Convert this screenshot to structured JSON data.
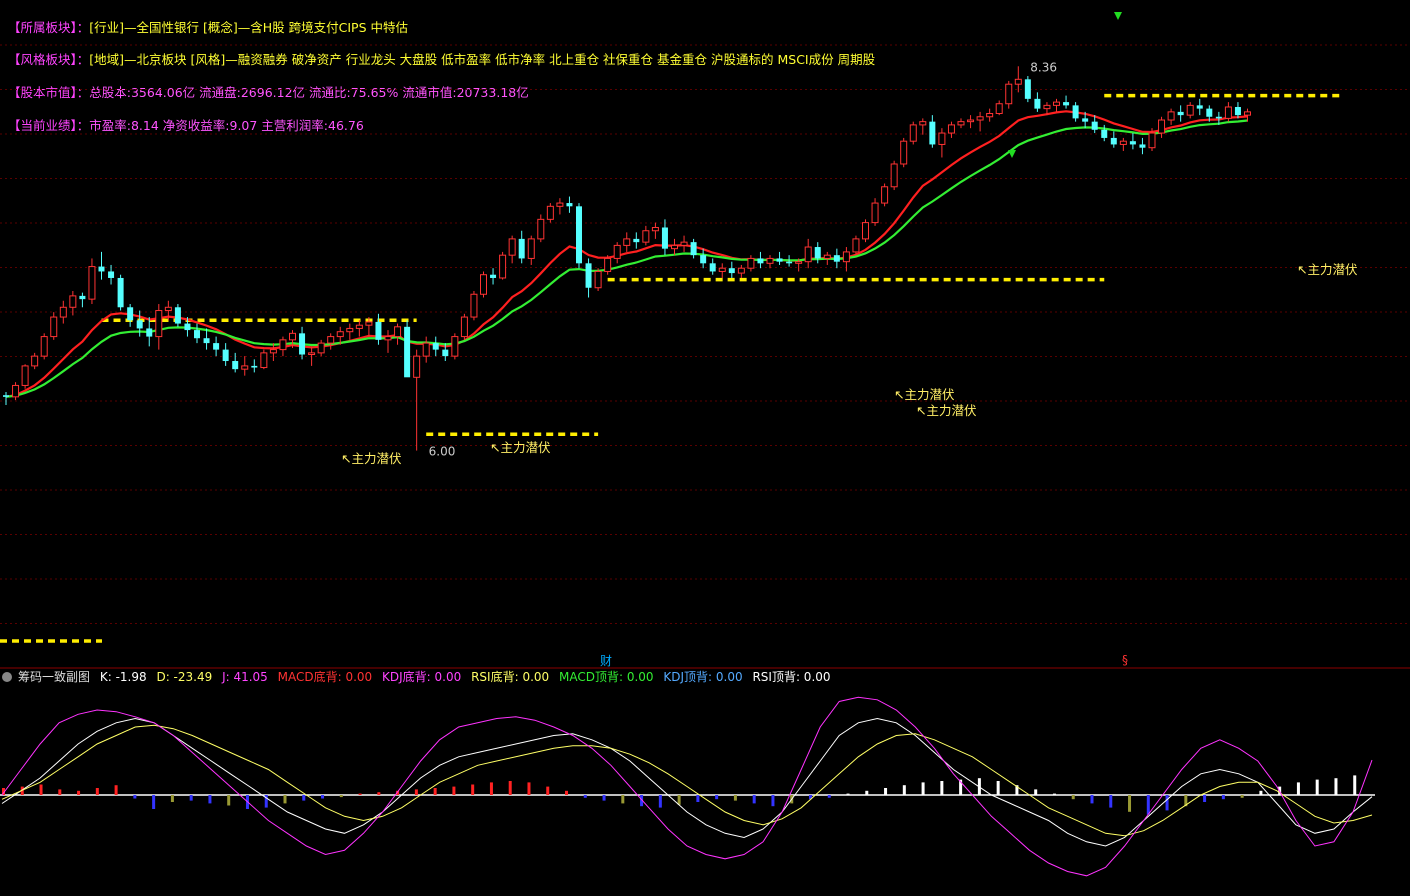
{
  "info_panel": {
    "sector": {
      "label": "【所属板块】：",
      "value": "[行业]—全国性银行 [概念]—含H股 跨境支付CIPS 中特估"
    },
    "style": {
      "label": "【风格板块】：",
      "value": "[地域]—北京板块 [风格]—融资融券 破净资产 行业龙头 大盘股 低市盈率 低市净率 北上重仓 社保重仓 基金重仓 沪股通标的 MSCI成份 周期股"
    },
    "capital": {
      "label": "【股本市值】：",
      "value": "总股本:3564.06亿 流通盘:2696.12亿 流通比:75.65% 流通市值:20733.18亿"
    },
    "performance": {
      "label": "【当前业绩】：",
      "value": "市盈率:8.14 净资收益率:9.07 主营利润率:46.76"
    }
  },
  "markers": {
    "cai": "财",
    "ss": "§"
  },
  "indicator_header": {
    "title": "筹码一致副图",
    "k": "K: -1.98",
    "d": "D: -23.49",
    "j": "J: 41.05",
    "macd_bottom": "MACD底背: 0.00",
    "kdj_bottom": "KDJ底背: 0.00",
    "rsi_bottom": "RSI底背: 0.00",
    "macd_top": "MACD顶背: 0.00",
    "kdj_top": "KDJ顶背: 0.00",
    "rsi_top": "RSI顶背: 0.00"
  },
  "colors": {
    "background": "#000000",
    "up_candle": "#ff3333",
    "down_candle": "#55ffff",
    "ma_fast": "#ff2020",
    "ma_slow": "#33ee33",
    "support_line": "#ffee00",
    "k_line": "#ffffff",
    "d_line": "#ffff66",
    "j_line": "#ff33ff"
  },
  "chart_data": [
    {
      "type": "candlestick",
      "max_label": "8.36",
      "min_label": "6.00",
      "annotation": "主力潜伏",
      "candles": [
        [
          6.34,
          6.36,
          6.28,
          6.33
        ],
        [
          6.33,
          6.42,
          6.31,
          6.4
        ],
        [
          6.4,
          6.53,
          6.38,
          6.52
        ],
        [
          6.52,
          6.6,
          6.5,
          6.58
        ],
        [
          6.58,
          6.72,
          6.56,
          6.7
        ],
        [
          6.7,
          6.85,
          6.68,
          6.82
        ],
        [
          6.82,
          6.92,
          6.78,
          6.88
        ],
        [
          6.88,
          6.98,
          6.83,
          6.95
        ],
        [
          6.95,
          6.97,
          6.88,
          6.93
        ],
        [
          6.93,
          7.18,
          6.9,
          7.13
        ],
        [
          7.13,
          7.22,
          7.05,
          7.1
        ],
        [
          7.1,
          7.14,
          7.02,
          7.06
        ],
        [
          7.06,
          7.08,
          6.86,
          6.88
        ],
        [
          6.88,
          6.9,
          6.76,
          6.8
        ],
        [
          6.8,
          6.86,
          6.7,
          6.75
        ],
        [
          6.75,
          6.82,
          6.64,
          6.7
        ],
        [
          6.7,
          6.9,
          6.62,
          6.86
        ],
        [
          6.86,
          6.92,
          6.8,
          6.88
        ],
        [
          6.88,
          6.9,
          6.76,
          6.78
        ],
        [
          6.78,
          6.82,
          6.7,
          6.74
        ],
        [
          6.74,
          6.78,
          6.66,
          6.69
        ],
        [
          6.69,
          6.75,
          6.62,
          6.66
        ],
        [
          6.66,
          6.7,
          6.58,
          6.62
        ],
        [
          6.62,
          6.66,
          6.52,
          6.55
        ],
        [
          6.55,
          6.6,
          6.48,
          6.5
        ],
        [
          6.5,
          6.58,
          6.46,
          6.52
        ],
        [
          6.52,
          6.56,
          6.48,
          6.51
        ],
        [
          6.51,
          6.62,
          6.5,
          6.6
        ],
        [
          6.6,
          6.66,
          6.55,
          6.62
        ],
        [
          6.62,
          6.7,
          6.58,
          6.68
        ],
        [
          6.68,
          6.74,
          6.63,
          6.72
        ],
        [
          6.72,
          6.76,
          6.56,
          6.59
        ],
        [
          6.59,
          6.64,
          6.52,
          6.6
        ],
        [
          6.6,
          6.68,
          6.58,
          6.66
        ],
        [
          6.66,
          6.72,
          6.62,
          6.7
        ],
        [
          6.7,
          6.76,
          6.65,
          6.73
        ],
        [
          6.73,
          6.78,
          6.68,
          6.75
        ],
        [
          6.75,
          6.8,
          6.7,
          6.77
        ],
        [
          6.77,
          6.82,
          6.7,
          6.79
        ],
        [
          6.79,
          6.84,
          6.65,
          6.68
        ],
        [
          6.68,
          6.74,
          6.6,
          6.7
        ],
        [
          6.7,
          6.78,
          6.65,
          6.76
        ],
        [
          6.76,
          6.8,
          6.52,
          6.45
        ],
        [
          6.45,
          6.62,
          6.0,
          6.58
        ],
        [
          6.58,
          6.7,
          6.54,
          6.66
        ],
        [
          6.66,
          6.7,
          6.58,
          6.62
        ],
        [
          6.62,
          6.66,
          6.55,
          6.58
        ],
        [
          6.58,
          6.72,
          6.56,
          6.7
        ],
        [
          6.7,
          6.84,
          6.68,
          6.82
        ],
        [
          6.82,
          6.98,
          6.8,
          6.96
        ],
        [
          6.96,
          7.1,
          6.94,
          7.08
        ],
        [
          7.08,
          7.12,
          7.02,
          7.06
        ],
        [
          7.06,
          7.22,
          7.05,
          7.2
        ],
        [
          7.2,
          7.32,
          7.15,
          7.3
        ],
        [
          7.3,
          7.35,
          7.15,
          7.18
        ],
        [
          7.18,
          7.32,
          7.14,
          7.3
        ],
        [
          7.3,
          7.45,
          7.28,
          7.42
        ],
        [
          7.42,
          7.52,
          7.4,
          7.5
        ],
        [
          7.5,
          7.55,
          7.45,
          7.52
        ],
        [
          7.52,
          7.56,
          7.46,
          7.5
        ],
        [
          7.5,
          7.52,
          7.12,
          7.15
        ],
        [
          7.15,
          7.18,
          6.94,
          7.0
        ],
        [
          7.0,
          7.12,
          6.98,
          7.1
        ],
        [
          7.1,
          7.2,
          7.08,
          7.18
        ],
        [
          7.18,
          7.28,
          7.15,
          7.26
        ],
        [
          7.26,
          7.34,
          7.22,
          7.3
        ],
        [
          7.3,
          7.34,
          7.24,
          7.28
        ],
        [
          7.28,
          7.38,
          7.26,
          7.35
        ],
        [
          7.35,
          7.4,
          7.3,
          7.37
        ],
        [
          7.37,
          7.42,
          7.2,
          7.24
        ],
        [
          7.24,
          7.3,
          7.2,
          7.26
        ],
        [
          7.26,
          7.32,
          7.22,
          7.28
        ],
        [
          7.28,
          7.3,
          7.18,
          7.2
        ],
        [
          7.2,
          7.24,
          7.12,
          7.15
        ],
        [
          7.15,
          7.18,
          7.08,
          7.1
        ],
        [
          7.1,
          7.15,
          7.06,
          7.12
        ],
        [
          7.12,
          7.16,
          7.06,
          7.09
        ],
        [
          7.09,
          7.14,
          7.06,
          7.12
        ],
        [
          7.12,
          7.2,
          7.1,
          7.18
        ],
        [
          7.18,
          7.22,
          7.12,
          7.15
        ],
        [
          7.15,
          7.2,
          7.12,
          7.18
        ],
        [
          7.18,
          7.22,
          7.14,
          7.16
        ],
        [
          7.16,
          7.2,
          7.13,
          7.15
        ],
        [
          7.15,
          7.18,
          7.1,
          7.16
        ],
        [
          7.16,
          7.3,
          7.12,
          7.25
        ],
        [
          7.25,
          7.28,
          7.15,
          7.18
        ],
        [
          7.18,
          7.22,
          7.14,
          7.2
        ],
        [
          7.2,
          7.24,
          7.12,
          7.16
        ],
        [
          7.16,
          7.25,
          7.1,
          7.22
        ],
        [
          7.22,
          7.32,
          7.2,
          7.3
        ],
        [
          7.3,
          7.42,
          7.28,
          7.4
        ],
        [
          7.4,
          7.55,
          7.38,
          7.52
        ],
        [
          7.52,
          7.64,
          7.5,
          7.62
        ],
        [
          7.62,
          7.78,
          7.6,
          7.76
        ],
        [
          7.76,
          7.92,
          7.74,
          7.9
        ],
        [
          7.9,
          8.02,
          7.88,
          8.0
        ],
        [
          8.0,
          8.04,
          7.94,
          8.02
        ],
        [
          8.02,
          8.06,
          7.86,
          7.88
        ],
        [
          7.88,
          7.98,
          7.8,
          7.95
        ],
        [
          7.95,
          8.02,
          7.92,
          8.0
        ],
        [
          8.0,
          8.04,
          7.98,
          8.02
        ],
        [
          8.02,
          8.06,
          7.98,
          8.03
        ],
        [
          8.03,
          8.08,
          7.96,
          8.05
        ],
        [
          8.05,
          8.1,
          8.02,
          8.07
        ],
        [
          8.07,
          8.15,
          8.06,
          8.13
        ],
        [
          8.13,
          8.27,
          8.1,
          8.25
        ],
        [
          8.25,
          8.36,
          8.2,
          8.28
        ],
        [
          8.28,
          8.3,
          8.14,
          8.16
        ],
        [
          8.16,
          8.2,
          8.08,
          8.1
        ],
        [
          8.1,
          8.14,
          8.06,
          8.12
        ],
        [
          8.12,
          8.16,
          8.08,
          8.14
        ],
        [
          8.14,
          8.18,
          8.1,
          8.12
        ],
        [
          8.12,
          8.14,
          8.02,
          8.04
        ],
        [
          8.04,
          8.08,
          7.98,
          8.02
        ],
        [
          8.02,
          8.06,
          7.95,
          7.97
        ],
        [
          7.97,
          8.0,
          7.9,
          7.92
        ],
        [
          7.92,
          7.96,
          7.86,
          7.88
        ],
        [
          7.88,
          7.92,
          7.84,
          7.9
        ],
        [
          7.9,
          7.95,
          7.85,
          7.88
        ],
        [
          7.88,
          7.92,
          7.82,
          7.86
        ],
        [
          7.86,
          7.98,
          7.84,
          7.95
        ],
        [
          7.95,
          8.05,
          7.92,
          8.03
        ],
        [
          8.03,
          8.1,
          8.0,
          8.08
        ],
        [
          8.08,
          8.12,
          8.02,
          8.06
        ],
        [
          8.06,
          8.14,
          8.04,
          8.12
        ],
        [
          8.12,
          8.16,
          8.06,
          8.1
        ],
        [
          8.1,
          8.12,
          8.02,
          8.05
        ],
        [
          8.05,
          8.08,
          8.0,
          8.04
        ],
        [
          8.04,
          8.14,
          8.02,
          8.11
        ],
        [
          8.11,
          8.14,
          8.04,
          8.06
        ],
        [
          8.06,
          8.1,
          8.02,
          8.08
        ]
      ],
      "ylim": [
        5.85,
        8.46
      ]
    },
    {
      "type": "line",
      "series": [
        {
          "name": "K",
          "values": [
            -10,
            5,
            20,
            40,
            60,
            75,
            85,
            90,
            85,
            70,
            55,
            40,
            25,
            10,
            -5,
            -20,
            -30,
            -40,
            -45,
            -35,
            -20,
            0,
            20,
            35,
            45,
            50,
            55,
            60,
            65,
            70,
            72,
            65,
            55,
            40,
            20,
            0,
            -20,
            -35,
            -45,
            -50,
            -40,
            -20,
            10,
            40,
            70,
            85,
            90,
            85,
            70,
            50,
            30,
            15,
            0,
            -10,
            -20,
            -30,
            -45,
            -55,
            -60,
            -50,
            -30,
            -10,
            10,
            25,
            30,
            25,
            15,
            -10,
            -35,
            -45,
            -40,
            -20,
            -1.98
          ]
        },
        {
          "name": "D",
          "values": [
            -5,
            5,
            15,
            30,
            45,
            60,
            70,
            80,
            82,
            78,
            70,
            60,
            50,
            40,
            30,
            15,
            0,
            -15,
            -25,
            -30,
            -25,
            -15,
            0,
            15,
            25,
            35,
            40,
            45,
            50,
            55,
            58,
            58,
            55,
            48,
            38,
            25,
            10,
            -5,
            -20,
            -30,
            -35,
            -28,
            -15,
            5,
            25,
            45,
            60,
            70,
            72,
            65,
            55,
            45,
            30,
            15,
            0,
            -15,
            -25,
            -35,
            -45,
            -48,
            -42,
            -30,
            -15,
            0,
            10,
            15,
            15,
            5,
            -10,
            -25,
            -33,
            -30,
            -23.49
          ]
        },
        {
          "name": "J",
          "values": [
            0,
            30,
            60,
            85,
            95,
            100,
            98,
            92,
            85,
            70,
            50,
            30,
            10,
            -10,
            -30,
            -45,
            -60,
            -70,
            -65,
            -45,
            -20,
            10,
            40,
            65,
            80,
            85,
            90,
            92,
            88,
            80,
            70,
            55,
            35,
            10,
            -15,
            -40,
            -60,
            -70,
            -75,
            -70,
            -55,
            -20,
            30,
            80,
            110,
            115,
            112,
            100,
            80,
            55,
            25,
            0,
            -25,
            -45,
            -65,
            -80,
            -90,
            -95,
            -85,
            -60,
            -30,
            0,
            30,
            55,
            65,
            55,
            40,
            10,
            -30,
            -60,
            -55,
            -20,
            41.05
          ]
        }
      ],
      "histogram": [
        10,
        12,
        15,
        8,
        6,
        10,
        14,
        -5,
        -20,
        -10,
        -8,
        -12,
        -15,
        -20,
        -18,
        -12,
        -8,
        -5,
        -3,
        2,
        4,
        6,
        8,
        10,
        12,
        15,
        18,
        20,
        18,
        12,
        6,
        -4,
        -8,
        -12,
        -16,
        -18,
        -14,
        -10,
        -6,
        -8,
        -12,
        -16,
        -12,
        -6,
        -4,
        2,
        6,
        10,
        14,
        18,
        20,
        22,
        24,
        20,
        14,
        8,
        2,
        -6,
        -12,
        -18,
        -24,
        -28,
        -22,
        -16,
        -10,
        -6,
        -4,
        6,
        12,
        18,
        22,
        24,
        28
      ]
    }
  ]
}
